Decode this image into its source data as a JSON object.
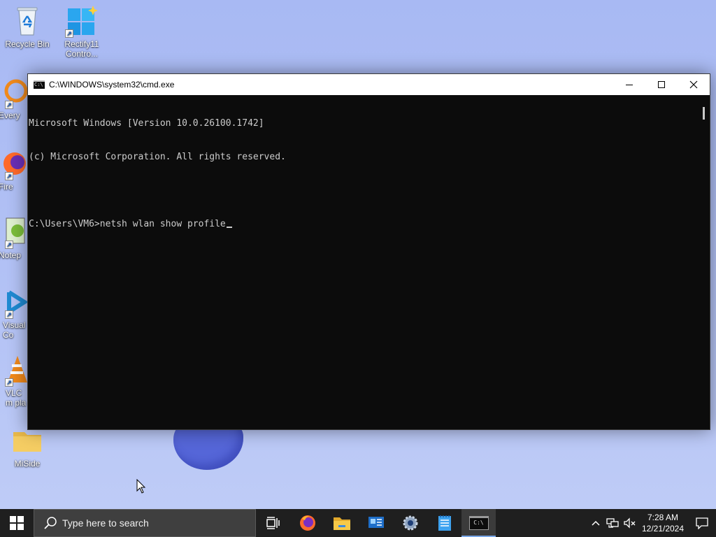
{
  "desktop": {
    "icons": [
      {
        "label": "Recycle Bin"
      },
      {
        "label": "Rectify11 Contro..."
      },
      {
        "label": "Every"
      },
      {
        "label": "Fire"
      },
      {
        "label": "Notep"
      },
      {
        "label": "Visual Co"
      },
      {
        "label": "VLC m pla"
      },
      {
        "label": "MiSide"
      }
    ]
  },
  "cmd_window": {
    "title": "C:\\WINDOWS\\system32\\cmd.exe",
    "lines": [
      "Microsoft Windows [Version 10.0.26100.1742]",
      "(c) Microsoft Corporation. All rights reserved.",
      "",
      "C:\\Users\\VM6>netsh wlan show profile"
    ],
    "icon_text": "C:\\"
  },
  "taskbar": {
    "search_placeholder": "Type here to search",
    "apps": [
      {
        "name": "task-view-icon"
      },
      {
        "name": "firefox-icon"
      },
      {
        "name": "file-explorer-icon"
      },
      {
        "name": "control-panel-icon"
      },
      {
        "name": "settings-gear-icon"
      },
      {
        "name": "notepad-icon"
      },
      {
        "name": "command-prompt-icon",
        "label": "C:\\"
      }
    ],
    "clock": {
      "time": "7:28 AM",
      "date": "12/21/2024"
    }
  },
  "colors": {
    "console_bg": "#0c0c0c",
    "console_fg": "#cccccc",
    "taskbar_bg": "#1f1f1f",
    "wallpaper": "#b3c2f5"
  }
}
